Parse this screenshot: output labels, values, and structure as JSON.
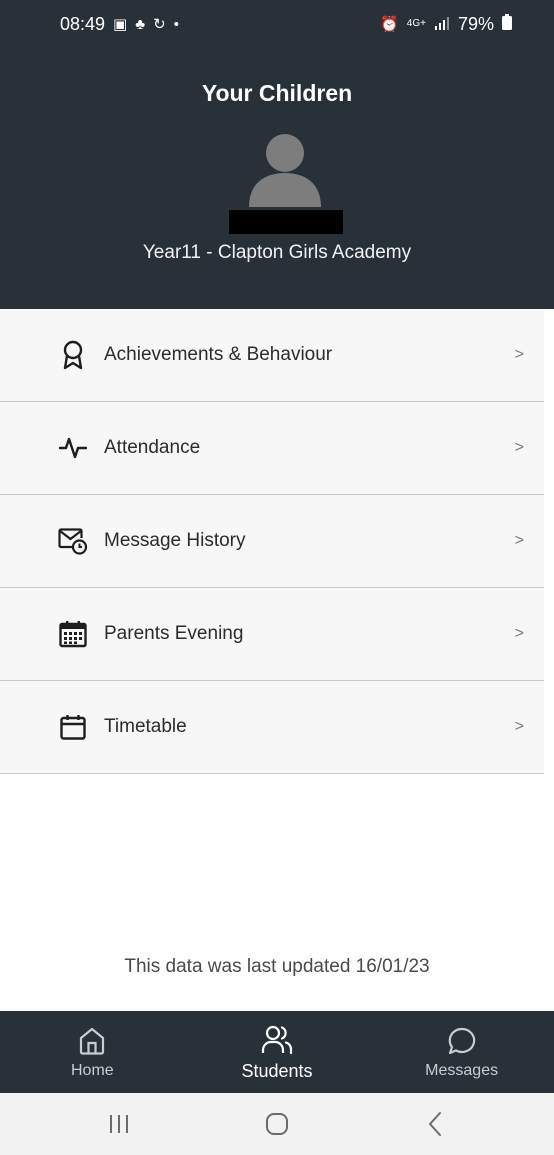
{
  "status_bar": {
    "time": "08:49",
    "battery": "79%",
    "network": "4G+"
  },
  "header": {
    "title": "Your Children",
    "subtitle": "Year11 - Clapton Girls Academy"
  },
  "menu": {
    "items": [
      {
        "label": "Achievements & Behaviour",
        "icon": "award-ribbon-icon",
        "chevron": ">"
      },
      {
        "label": "Attendance",
        "icon": "activity-pulse-icon",
        "chevron": ">"
      },
      {
        "label": "Message History",
        "icon": "mail-clock-icon",
        "chevron": ">"
      },
      {
        "label": "Parents Evening",
        "icon": "calendar-grid-icon",
        "chevron": ">"
      },
      {
        "label": "Timetable",
        "icon": "calendar-icon",
        "chevron": ">"
      }
    ]
  },
  "footer_note": "This data was last updated 16/01/23",
  "bottom_nav": {
    "items": [
      {
        "label": "Home",
        "icon": "home-icon",
        "active": false
      },
      {
        "label": "Students",
        "icon": "users-icon",
        "active": true
      },
      {
        "label": "Messages",
        "icon": "chat-bubble-icon",
        "active": false
      }
    ]
  },
  "colors": {
    "header_bg": "#283038",
    "menu_bg": "#f7f7f7",
    "divider": "#c8c8c8"
  }
}
